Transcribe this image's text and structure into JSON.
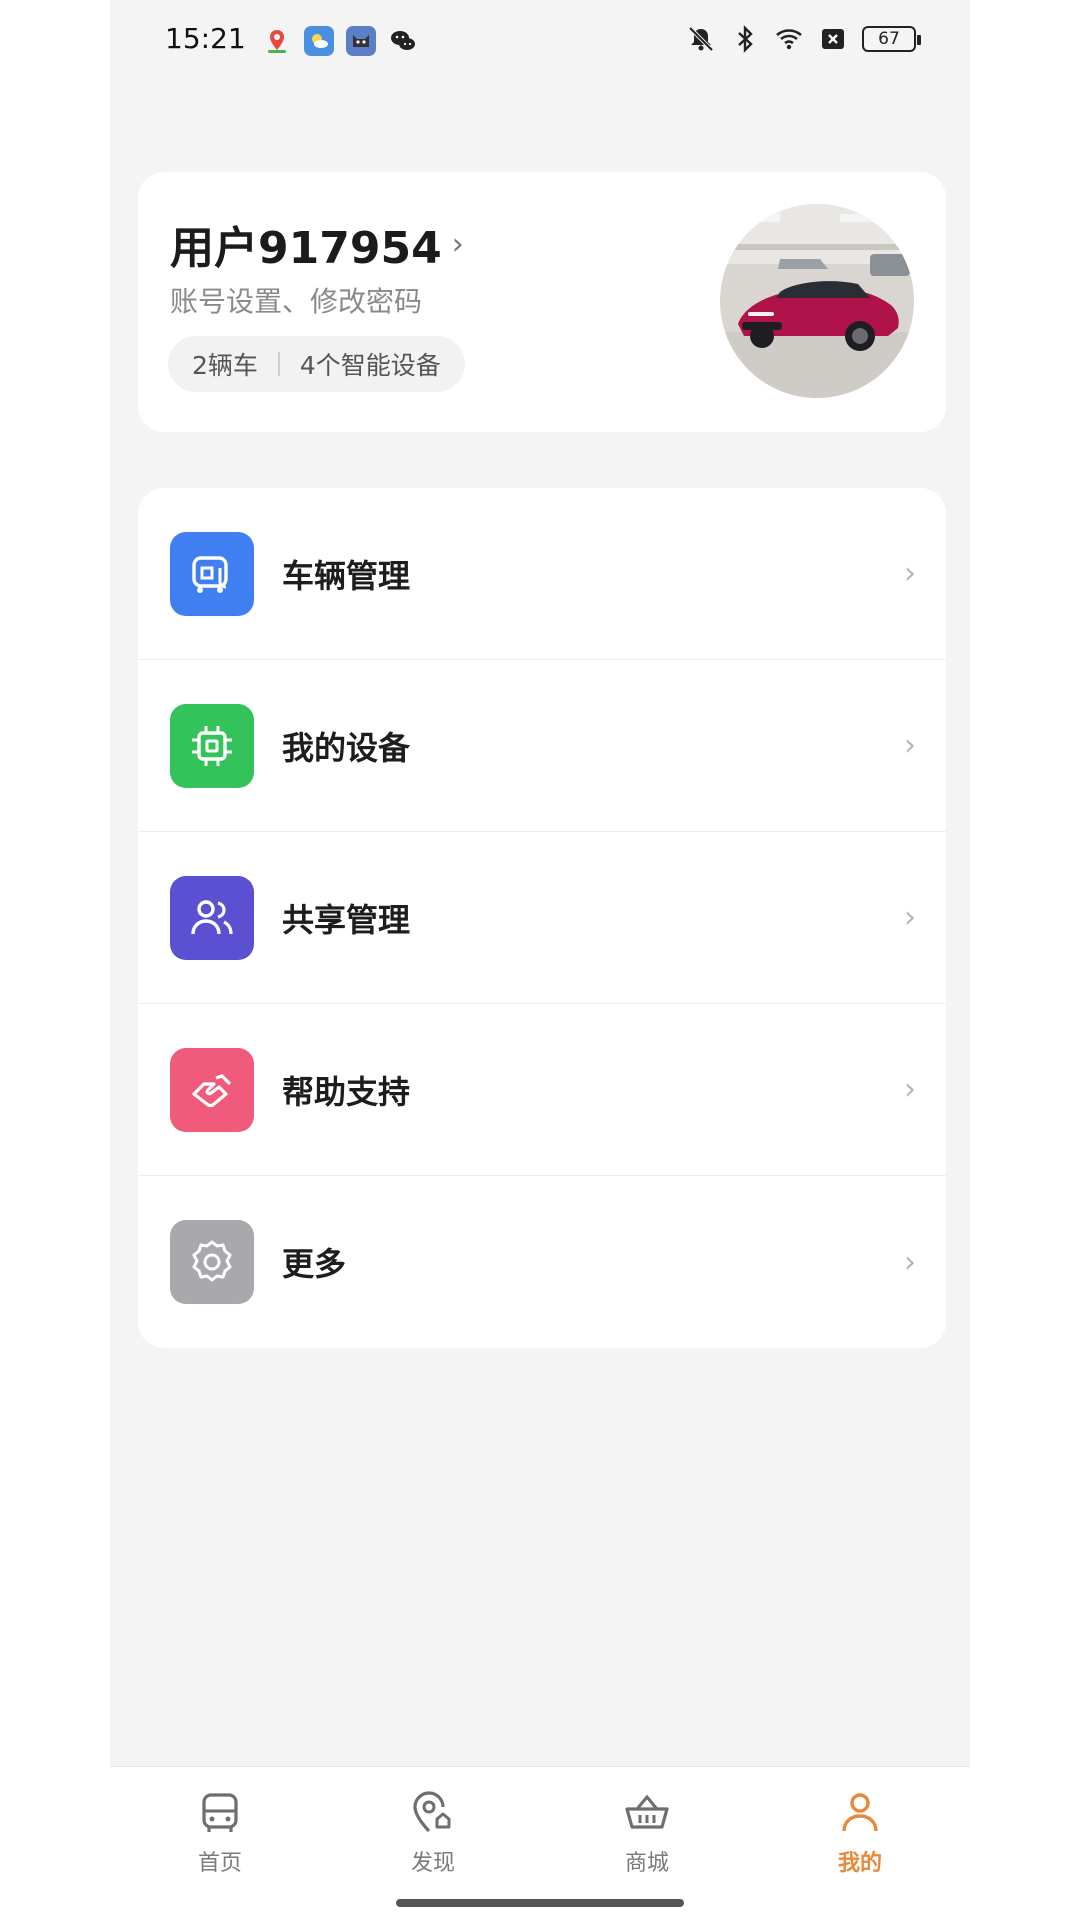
{
  "status_bar": {
    "time": "15:21",
    "app_icons": [
      "maps-pin-icon",
      "weather-icon",
      "cat-app-icon",
      "wechat-icon"
    ],
    "battery": "67"
  },
  "profile": {
    "name": "用户917954",
    "subtitle": "账号设置、修改密码",
    "vehicles": "2辆车",
    "devices": "4个智能设备"
  },
  "menu": [
    {
      "label": "车辆管理",
      "icon": "vehicle-icon",
      "color": "#3f7ff1"
    },
    {
      "label": "我的设备",
      "icon": "chip-icon",
      "color": "#34c35a"
    },
    {
      "label": "共享管理",
      "icon": "users-icon",
      "color": "#5b4fd2"
    },
    {
      "label": "帮助支持",
      "icon": "handshake-icon",
      "color": "#f05b7b"
    },
    {
      "label": "更多",
      "icon": "gear-icon",
      "color": "#a9a9ad"
    }
  ],
  "chevron": "›",
  "bottom_nav": [
    {
      "label": "首页",
      "icon": "car-front-icon",
      "active": false
    },
    {
      "label": "发现",
      "icon": "discover-icon",
      "active": false
    },
    {
      "label": "商城",
      "icon": "basket-icon",
      "active": false
    },
    {
      "label": "我的",
      "icon": "person-icon",
      "active": true
    }
  ],
  "colors": {
    "accent": "#e8883a",
    "background": "#f4f4f4"
  }
}
